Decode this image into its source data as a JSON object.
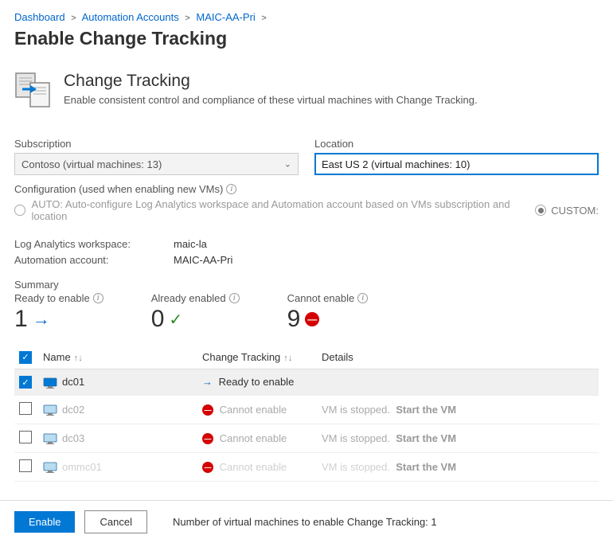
{
  "breadcrumb": [
    {
      "label": "Dashboard"
    },
    {
      "label": "Automation Accounts"
    },
    {
      "label": "MAIC-AA-Pri"
    }
  ],
  "page_title": "Enable Change Tracking",
  "hero": {
    "title": "Change Tracking",
    "description": "Enable consistent control and compliance of these virtual machines with Change Tracking."
  },
  "subscription": {
    "label": "Subscription",
    "value": "Contoso (virtual machines: 13)"
  },
  "location": {
    "label": "Location",
    "value": "East US 2 (virtual machines: 10)"
  },
  "config": {
    "label": "Configuration (used when enabling new VMs)",
    "auto_label": "AUTO: Auto-configure Log Analytics workspace and Automation account based on VMs subscription and location",
    "custom_label": "CUSTOM:"
  },
  "workspace": {
    "log_label": "Log Analytics workspace:",
    "log_value": "maic-la",
    "auto_label": "Automation account:",
    "auto_value": "MAIC-AA-Pri"
  },
  "summary": {
    "label": "Summary",
    "ready": {
      "label": "Ready to enable",
      "value": "1"
    },
    "already": {
      "label": "Already enabled",
      "value": "0"
    },
    "cannot": {
      "label": "Cannot enable",
      "value": "9"
    }
  },
  "table": {
    "headers": {
      "name": "Name",
      "tracking": "Change Tracking",
      "details": "Details"
    },
    "rows": [
      {
        "checked": true,
        "name": "dc01",
        "status": "ready",
        "status_text": "Ready to enable",
        "details": "",
        "action": ""
      },
      {
        "checked": false,
        "name": "dc02",
        "status": "cannot",
        "status_text": "Cannot enable",
        "details": "VM is stopped.",
        "action": "Start the VM"
      },
      {
        "checked": false,
        "name": "dc03",
        "status": "cannot",
        "status_text": "Cannot enable",
        "details": "VM is stopped.",
        "action": "Start the VM"
      },
      {
        "checked": false,
        "name": "ommc01",
        "status": "cannot",
        "status_text": "Cannot enable",
        "details": "VM is stopped.",
        "action": "Start the VM"
      }
    ]
  },
  "footer": {
    "enable": "Enable",
    "cancel": "Cancel",
    "count_text": "Number of virtual machines to enable Change Tracking: 1"
  }
}
